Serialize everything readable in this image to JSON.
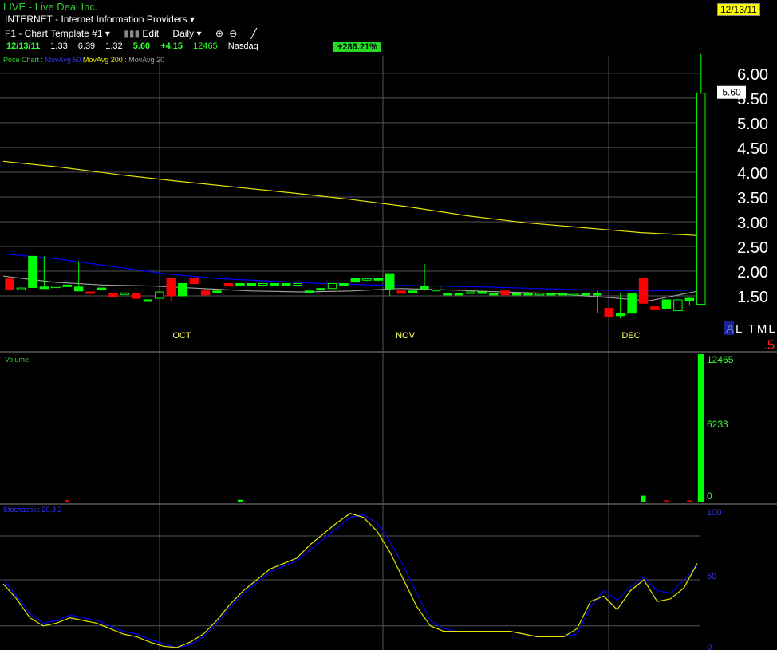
{
  "header": {
    "title": "LIVE  - Live Deal Inc.",
    "date_badge": "12/13/11",
    "industry": "INTERNET - Internet Information Providers",
    "template": "F1 - Chart Template #1",
    "edit": "Edit",
    "period": "Daily"
  },
  "quote": {
    "date": "12/13/11",
    "open": "1.33",
    "high": "6.39",
    "low": "1.32",
    "close": "5.60",
    "change": "+4.15",
    "volume": "12465",
    "exchange": "Nasdaq",
    "pct_change": "+286.21%"
  },
  "legend": {
    "price_chart": "Price Chart :",
    "ma50": "MovAvg 50",
    "ma200": "MovAvg 200 :",
    "ma20": "MovAvg 20"
  },
  "watermark": {
    "text": "AL TML",
    "sub": ".5"
  },
  "colors": {
    "up": "#00ff00",
    "down": "#ff0000",
    "ma50": "#0000ff",
    "ma200": "#e6e600",
    "ma20": "#a0a0a0",
    "grid": "#555555"
  },
  "chart_data": [
    {
      "type": "candlestick",
      "title": "Price Chart",
      "x_tick_labels": [
        "OCT",
        "NOV",
        "DEC"
      ],
      "y_ticks": [
        1.5,
        2.0,
        2.5,
        3.0,
        3.5,
        4.0,
        4.5,
        5.0,
        5.5,
        6.0
      ],
      "ylim": [
        1.0,
        6.45
      ],
      "last_price_label": "5.60",
      "ohlc": [
        [
          1.84,
          1.84,
          1.62,
          1.62
        ],
        [
          1.65,
          1.66,
          1.65,
          1.66
        ],
        [
          1.67,
          2.3,
          1.67,
          2.3
        ],
        [
          1.68,
          2.3,
          1.68,
          1.68
        ],
        [
          1.7,
          1.7,
          1.7,
          1.7
        ],
        [
          1.72,
          1.72,
          1.72,
          1.72
        ],
        [
          1.6,
          2.2,
          1.6,
          1.68
        ],
        [
          1.58,
          1.58,
          1.55,
          1.55
        ],
        [
          1.66,
          1.66,
          1.66,
          1.66
        ],
        [
          1.55,
          1.55,
          1.48,
          1.48
        ],
        [
          1.55,
          1.56,
          1.54,
          1.56
        ],
        [
          1.54,
          1.54,
          1.45,
          1.45
        ],
        [
          1.42,
          1.42,
          1.42,
          1.42
        ],
        [
          1.45,
          1.58,
          1.45,
          1.58
        ],
        [
          1.85,
          1.85,
          1.4,
          1.5
        ],
        [
          1.5,
          1.75,
          1.5,
          1.75
        ],
        [
          1.85,
          1.85,
          1.75,
          1.75
        ],
        [
          1.6,
          1.62,
          1.5,
          1.52
        ],
        [
          1.6,
          1.6,
          1.6,
          1.6
        ],
        [
          1.75,
          1.75,
          1.7,
          1.7
        ],
        [
          1.75,
          1.75,
          1.75,
          1.75
        ],
        [
          1.75,
          1.75,
          1.75,
          1.75
        ],
        [
          1.75,
          1.75,
          1.75,
          1.75
        ],
        [
          1.75,
          1.75,
          1.75,
          1.75
        ],
        [
          1.75,
          1.75,
          1.75,
          1.75
        ],
        [
          1.75,
          1.75,
          1.75,
          1.75
        ],
        [
          1.6,
          1.6,
          1.6,
          1.6
        ],
        [
          1.65,
          1.65,
          1.65,
          1.65
        ],
        [
          1.65,
          1.75,
          1.65,
          1.75
        ],
        [
          1.75,
          1.75,
          1.75,
          1.75
        ],
        [
          1.78,
          1.85,
          1.78,
          1.85
        ],
        [
          1.85,
          1.85,
          1.8,
          1.85
        ],
        [
          1.85,
          1.85,
          1.8,
          1.85
        ],
        [
          1.65,
          1.95,
          1.5,
          1.95
        ],
        [
          1.6,
          1.6,
          1.55,
          1.55
        ],
        [
          1.6,
          1.6,
          1.6,
          1.6
        ],
        [
          1.65,
          2.15,
          1.6,
          1.7
        ],
        [
          1.6,
          2.1,
          1.6,
          1.7
        ],
        [
          1.55,
          1.55,
          1.55,
          1.55
        ],
        [
          1.55,
          1.55,
          1.55,
          1.55
        ],
        [
          1.58,
          1.58,
          1.58,
          1.58
        ],
        [
          1.58,
          1.58,
          1.58,
          1.58
        ],
        [
          1.55,
          1.55,
          1.55,
          1.55
        ],
        [
          1.6,
          1.6,
          1.52,
          1.52
        ],
        [
          1.55,
          1.55,
          1.55,
          1.55
        ],
        [
          1.55,
          1.55,
          1.55,
          1.55
        ],
        [
          1.55,
          1.55,
          1.55,
          1.55
        ],
        [
          1.55,
          1.55,
          1.55,
          1.55
        ],
        [
          1.55,
          1.55,
          1.55,
          1.55
        ],
        [
          1.55,
          1.55,
          1.55,
          1.55
        ],
        [
          1.55,
          1.55,
          1.55,
          1.55
        ],
        [
          1.55,
          1.6,
          1.15,
          1.55
        ],
        [
          1.25,
          1.25,
          1.08,
          1.08
        ],
        [
          1.1,
          1.55,
          1.05,
          1.15
        ],
        [
          1.15,
          1.55,
          1.15,
          1.55
        ],
        [
          1.85,
          1.85,
          1.35,
          1.35
        ],
        [
          1.28,
          1.28,
          1.22,
          1.22
        ],
        [
          1.25,
          1.42,
          1.25,
          1.42
        ],
        [
          1.2,
          1.42,
          1.2,
          1.42
        ],
        [
          1.4,
          1.47,
          1.3,
          1.45
        ],
        [
          1.33,
          6.39,
          1.32,
          5.6
        ]
      ],
      "ma200": [
        4.22,
        4.1,
        3.95,
        3.82,
        3.7,
        3.58,
        3.45,
        3.3,
        3.12,
        2.98,
        2.88,
        2.78,
        2.72
      ],
      "ma50": [
        2.35,
        2.25,
        2.1,
        1.95,
        1.85,
        1.8,
        1.75,
        1.72,
        1.7,
        1.68,
        1.65,
        1.62,
        1.6,
        1.62
      ],
      "ma20": [
        1.9,
        1.78,
        1.72,
        1.7,
        1.65,
        1.6,
        1.58,
        1.6,
        1.65,
        1.62,
        1.58,
        1.55,
        1.48,
        1.4,
        1.6
      ]
    },
    {
      "type": "bar",
      "title": "Volume",
      "y_tick_labels": [
        "12465",
        "6233",
        "0"
      ],
      "ylim": [
        0,
        12465
      ],
      "values": [
        0,
        0,
        0,
        0,
        0,
        0,
        0,
        0,
        0,
        0,
        0,
        0,
        0,
        0,
        0,
        0,
        0,
        0,
        0,
        0,
        0,
        0,
        0,
        0,
        0,
        0,
        0,
        0,
        0,
        0,
        0,
        0,
        0,
        0,
        0,
        0,
        0,
        0,
        0,
        0,
        0,
        0,
        0,
        0,
        0,
        0,
        0,
        0,
        0,
        0,
        0,
        0,
        0,
        0,
        0,
        0,
        0,
        0,
        0,
        0,
        12465
      ],
      "small_bars": [
        {
          "index": 5,
          "value": 120,
          "color": "down"
        },
        {
          "index": 20,
          "value": 150,
          "color": "up"
        },
        {
          "index": 55,
          "value": 500,
          "color": "up"
        },
        {
          "index": 57,
          "value": 80,
          "color": "down"
        },
        {
          "index": 59,
          "value": 80,
          "color": "down"
        }
      ]
    },
    {
      "type": "line",
      "title": "Stochastics 20,3,2",
      "y_tick_labels": [
        "100",
        "50",
        "0"
      ],
      "ylim": [
        0,
        100
      ],
      "series": [
        {
          "values": [
            50,
            38,
            25,
            18,
            20,
            24,
            22,
            20,
            16,
            12,
            10,
            6,
            3,
            0,
            2,
            8,
            18,
            30,
            40,
            48,
            56,
            60,
            64,
            72,
            80,
            88,
            96,
            98,
            92,
            78,
            60,
            40,
            20,
            14,
            12,
            12,
            12,
            12,
            12,
            10,
            8,
            8,
            8,
            10,
            30,
            42,
            35,
            45,
            52,
            42,
            40,
            50,
            60
          ]
        },
        {
          "values": [
            47,
            36,
            22,
            16,
            18,
            22,
            20,
            18,
            14,
            10,
            8,
            4,
            1,
            0,
            4,
            10,
            20,
            32,
            42,
            50,
            58,
            62,
            66,
            76,
            84,
            92,
            99,
            96,
            86,
            70,
            50,
            30,
            16,
            12,
            12,
            12,
            12,
            12,
            12,
            10,
            8,
            8,
            8,
            14,
            34,
            38,
            28,
            42,
            50,
            34,
            36,
            44,
            62
          ]
        }
      ]
    }
  ]
}
